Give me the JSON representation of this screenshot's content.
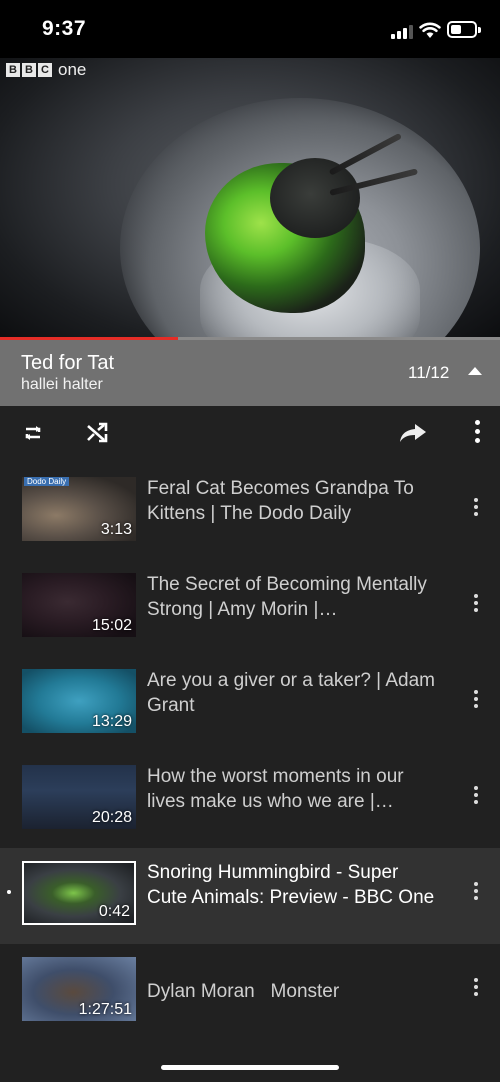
{
  "status_bar": {
    "time": "9:37"
  },
  "player": {
    "channel_logo": {
      "letters": [
        "B",
        "B",
        "C"
      ],
      "word": "one"
    },
    "progress": 0.355
  },
  "playlist": {
    "title": "Ted for Tat",
    "owner": "hallei halter",
    "position": "11/12"
  },
  "controls": {
    "icons": [
      "repeat-icon",
      "shuffle-icon",
      "share-icon",
      "more-vert-icon"
    ]
  },
  "items": [
    {
      "title": "Feral Cat Becomes Grandpa To Kittens | The Dodo Daily",
      "duration": "3:13",
      "thumb_tag": "Dodo Daily",
      "current": false
    },
    {
      "title": "The Secret of Becoming Mentally Strong | Amy Morin | TEDxOaksChristianSchool",
      "duration": "15:02",
      "current": false
    },
    {
      "title": "Are you a giver or a taker? | Adam Grant",
      "duration": "13:29",
      "current": false
    },
    {
      "title": "How the worst moments in our lives make us who we are | Andrew Solomon",
      "duration": "20:28",
      "current": false
    },
    {
      "title": "Snoring Hummingbird - Super Cute Animals: Preview - BBC One",
      "duration": "0:42",
      "current": true
    },
    {
      "title": "Dylan Moran   Monster",
      "duration": "1:27:51",
      "current": false
    }
  ]
}
